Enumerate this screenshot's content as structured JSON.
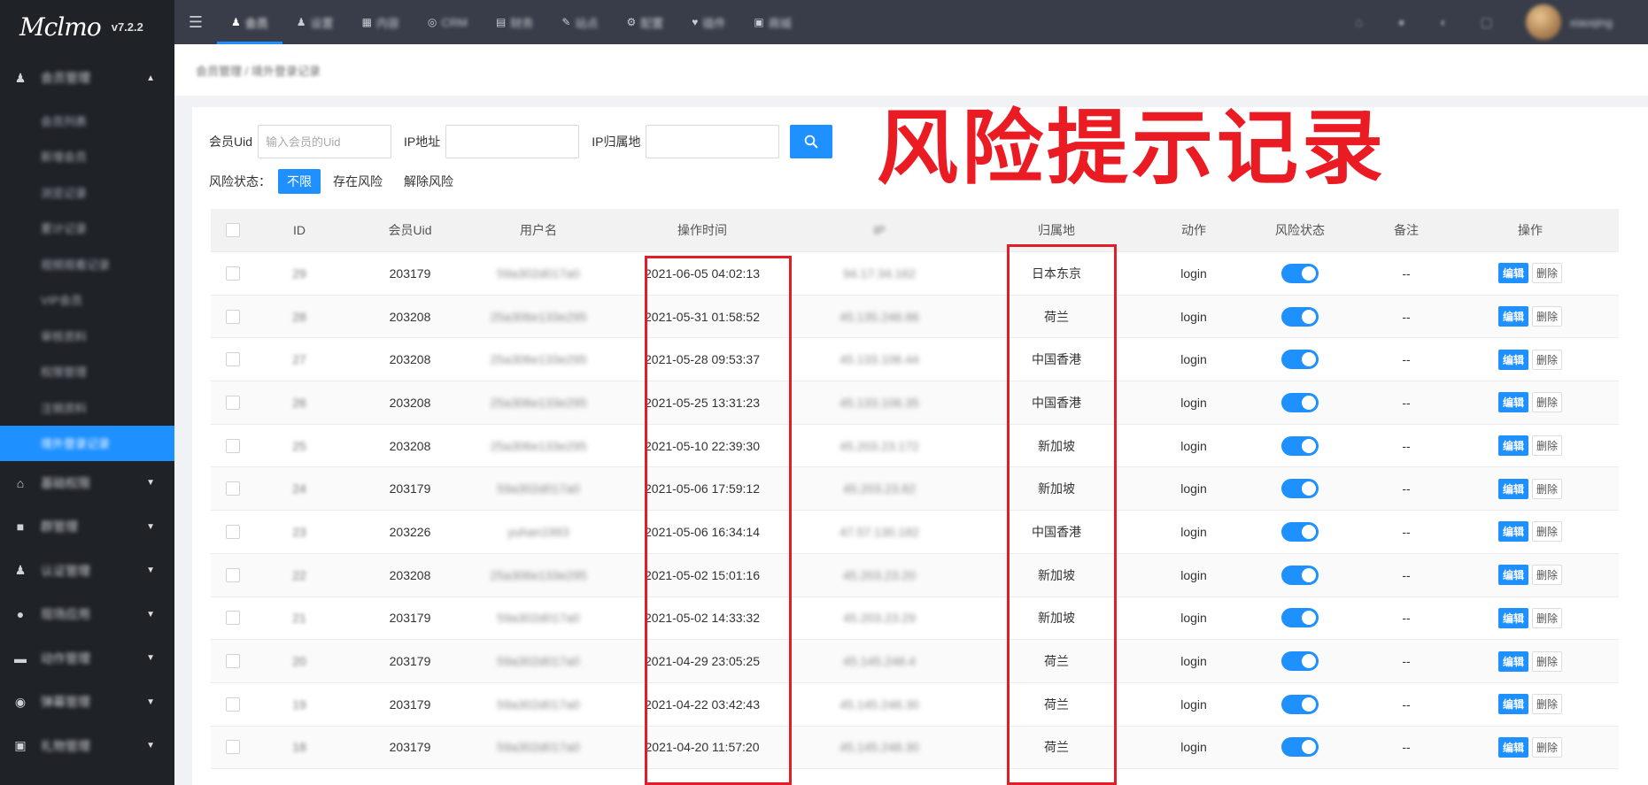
{
  "app": {
    "logo": "Mclmo",
    "version": "v7.2.2"
  },
  "sidebar": {
    "group_open": {
      "label": "会员管理",
      "icon": "users-icon"
    },
    "sub_items": [
      "会员列表",
      "新增会员",
      "浏览记录",
      "累计记录",
      "视频观看记录",
      "VIP会员",
      "审核资料",
      "权限管理",
      "注销资料",
      "境外登录记录"
    ],
    "groups": [
      {
        "label": "基础权限",
        "icon": "home-icon"
      },
      {
        "label": "群管理",
        "icon": "group-icon"
      },
      {
        "label": "认证管理",
        "icon": "user-check-icon"
      },
      {
        "label": "现场应用",
        "icon": "globe-icon"
      },
      {
        "label": "动作管理",
        "icon": "monitor-icon"
      },
      {
        "label": "弹幕管理",
        "icon": "pin-icon"
      },
      {
        "label": "礼物管理",
        "icon": "gift-icon"
      }
    ]
  },
  "topnav": {
    "items": [
      {
        "label": "会员",
        "icon": "user-icon",
        "active": true
      },
      {
        "label": "设置",
        "icon": "user-icon"
      },
      {
        "label": "内容",
        "icon": "grid-icon"
      },
      {
        "label": "CRM",
        "icon": "globe-icon"
      },
      {
        "label": "财务",
        "icon": "table-icon"
      },
      {
        "label": "站点",
        "icon": "edit-icon"
      },
      {
        "label": "配置",
        "icon": "gear-icon"
      },
      {
        "label": "插件",
        "icon": "heart-icon"
      },
      {
        "label": "商城",
        "icon": "cart-icon"
      }
    ],
    "user_name": "xiaoqing"
  },
  "breadcrumb": "会员管理 / 境外登录记录",
  "filters": {
    "uid_label": "会员Uid",
    "uid_placeholder": "输入会员的Uid",
    "ip_label": "IP地址",
    "ip_loc_label": "IP归属地",
    "risk_label": "风险状态：",
    "risk_options": [
      "不限",
      "存在风险",
      "解除风险"
    ]
  },
  "overlay_title": "风险提示记录",
  "table": {
    "headers": [
      "ID",
      "会员Uid",
      "用户名",
      "操作时间",
      "IP",
      "归属地",
      "动作",
      "风险状态",
      "备注",
      "操作"
    ],
    "edit_label": "编辑",
    "delete_label": "删除",
    "rows": [
      {
        "id": "29",
        "uid": "203179",
        "username": "59a302d017a0",
        "time": "2021-06-05 04:02:13",
        "ip": "94.17.34.162",
        "location": "日本东京",
        "action": "login",
        "note": "--"
      },
      {
        "id": "28",
        "uid": "203208",
        "username": "25a306e133e295",
        "time": "2021-05-31 01:58:52",
        "ip": "45.135.248.86",
        "location": "荷兰",
        "action": "login",
        "note": "--"
      },
      {
        "id": "27",
        "uid": "203208",
        "username": "25a306e133e295",
        "time": "2021-05-28 09:53:37",
        "ip": "45.133.106.44",
        "location": "中国香港",
        "action": "login",
        "note": "--"
      },
      {
        "id": "26",
        "uid": "203208",
        "username": "25a306e133e295",
        "time": "2021-05-25 13:31:23",
        "ip": "45.133.106.35",
        "location": "中国香港",
        "action": "login",
        "note": "--"
      },
      {
        "id": "25",
        "uid": "203208",
        "username": "25a306e133e295",
        "time": "2021-05-10 22:39:30",
        "ip": "45.203.23.172",
        "location": "新加坡",
        "action": "login",
        "note": "--"
      },
      {
        "id": "24",
        "uid": "203179",
        "username": "59a302d017a0",
        "time": "2021-05-06 17:59:12",
        "ip": "45.203.23.82",
        "location": "新加坡",
        "action": "login",
        "note": "--"
      },
      {
        "id": "23",
        "uid": "203226",
        "username": "yuhan1993",
        "time": "2021-05-06 16:34:14",
        "ip": "47.57.130.182",
        "location": "中国香港",
        "action": "login",
        "note": "--"
      },
      {
        "id": "22",
        "uid": "203208",
        "username": "25a306e133e295",
        "time": "2021-05-02 15:01:16",
        "ip": "45.203.23.20",
        "location": "新加坡",
        "action": "login",
        "note": "--"
      },
      {
        "id": "21",
        "uid": "203179",
        "username": "59a302d017a0",
        "time": "2021-05-02 14:33:32",
        "ip": "45.203.23.29",
        "location": "新加坡",
        "action": "login",
        "note": "--"
      },
      {
        "id": "20",
        "uid": "203179",
        "username": "59a302d017a0",
        "time": "2021-04-29 23:05:25",
        "ip": "45.145.248.4",
        "location": "荷兰",
        "action": "login",
        "note": "--"
      },
      {
        "id": "19",
        "uid": "203179",
        "username": "59a302d017a0",
        "time": "2021-04-22 03:42:43",
        "ip": "45.145.248.30",
        "location": "荷兰",
        "action": "login",
        "note": "--"
      },
      {
        "id": "18",
        "uid": "203179",
        "username": "59a302d017a0",
        "time": "2021-04-20 11:57:20",
        "ip": "45.145.248.30",
        "location": "荷兰",
        "action": "login",
        "note": "--"
      }
    ]
  },
  "colors": {
    "primary": "#1e90ff",
    "sidebar_bg": "#1f2227",
    "topbar_bg": "#393d49",
    "highlight_red": "#e11d2a"
  }
}
